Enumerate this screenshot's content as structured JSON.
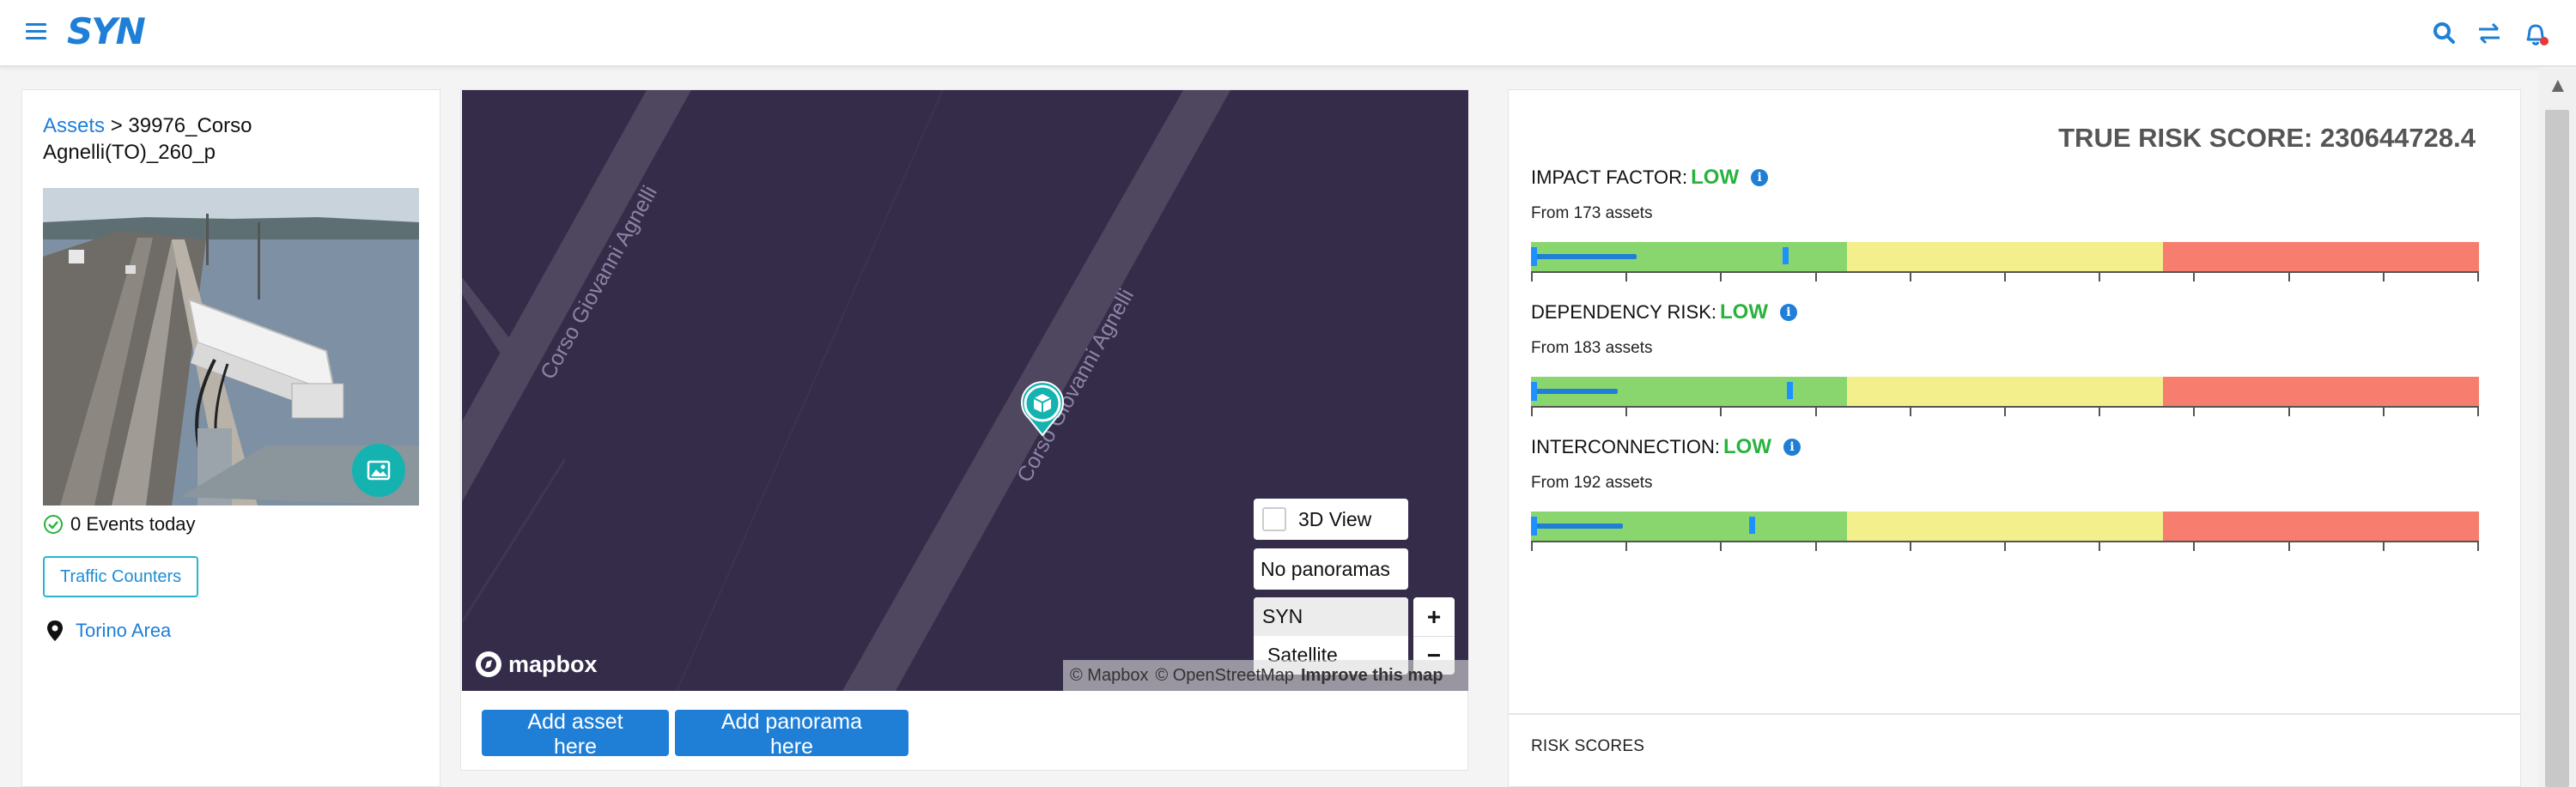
{
  "app": {
    "logo": "SYN",
    "icons": [
      "menu-icon",
      "search-icon",
      "swap-icon",
      "bell-icon"
    ]
  },
  "asset": {
    "breadcrumb_root": "Assets",
    "breadcrumb_sep": ">",
    "name": "39976_Corso Agnelli(TO)_260_p",
    "events_today": "0 Events today",
    "tag_button": "Traffic Counters",
    "location": "Torino Area"
  },
  "map": {
    "street_labels": [
      "Corso Giovanni Agnelli",
      "Corso Giovanni Agnelli"
    ],
    "view_3d_label": "3D View",
    "panoramas_label": "No panoramas",
    "layers": [
      {
        "label": "SYN",
        "selected": true
      },
      {
        "label": "Satellite",
        "selected": false
      }
    ],
    "zoom_in": "+",
    "zoom_out": "−",
    "brand": "mapbox",
    "attribution": {
      "a": "© Mapbox",
      "b": "© OpenStreetMap",
      "c": "Improve this map"
    },
    "add_asset_button": "Add asset here",
    "add_panorama_button": "Add panorama here",
    "colors": {
      "background": "#352c4a",
      "road": "#4e475f",
      "pin": "#14b3b0"
    }
  },
  "risk": {
    "true_risk_score": "TRUE RISK SCORE: 230644728.4",
    "factors": [
      {
        "title": "IMPACT FACTOR:",
        "level": "LOW",
        "from": "From 173 assets",
        "range_end": 0.11,
        "marker": 0.265
      },
      {
        "title": "DEPENDENCY RISK:",
        "level": "LOW",
        "from": "From 183 assets",
        "range_end": 0.09,
        "marker": 0.27
      },
      {
        "title": "INTERCONNECTION:",
        "level": "LOW",
        "from": "From 192 assets",
        "range_end": 0.095,
        "marker": 0.23
      }
    ],
    "bands": [
      {
        "label": "low",
        "color": "#8ad66e"
      },
      {
        "label": "medium",
        "color": "#f3ef8d"
      },
      {
        "label": "high",
        "color": "#f77e6e"
      }
    ],
    "footer": "RISK SCORES"
  }
}
